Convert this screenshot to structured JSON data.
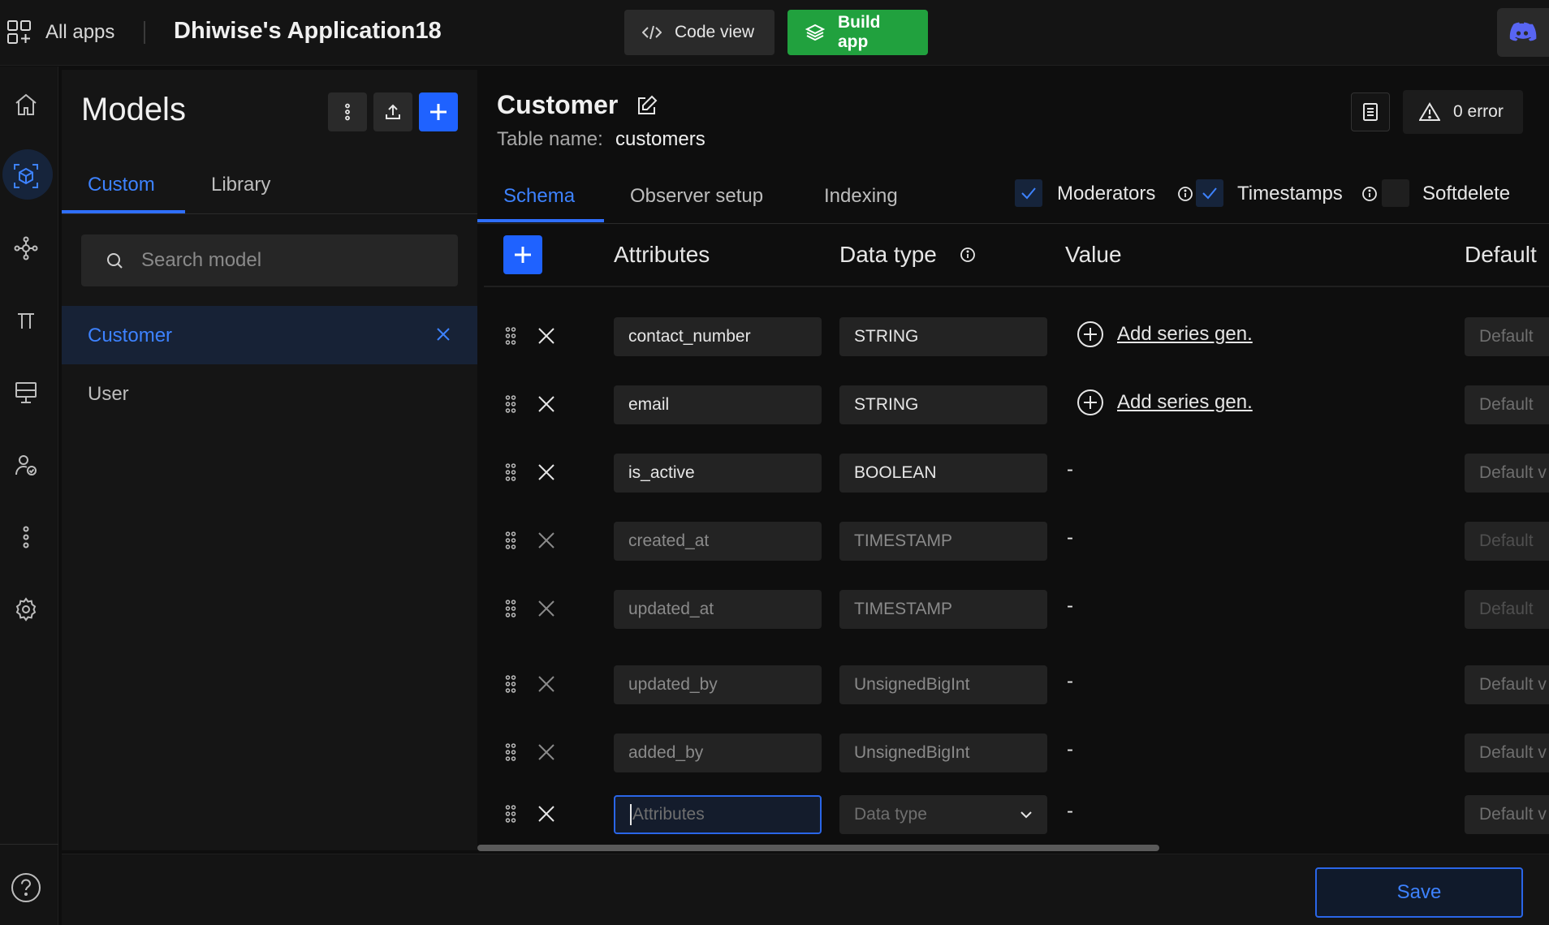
{
  "topbar": {
    "all_apps": "All apps",
    "app_title": "Dhiwise's Application18",
    "code_view": "Code view",
    "build_app": "Build app"
  },
  "colors": {
    "accent": "#1f62ff",
    "build_green": "#21a13e",
    "discord": "#5865f2"
  },
  "panel": {
    "title": "Models",
    "tabs": [
      "Custom",
      "Library"
    ],
    "search_placeholder": "Search model",
    "models": [
      "Customer",
      "User"
    ]
  },
  "main": {
    "model_name": "Customer",
    "table_name_label": "Table name:",
    "table_name": "customers",
    "error_label": "0 error",
    "tabs": [
      "Schema",
      "Observer setup",
      "Indexing"
    ],
    "options": {
      "moderators": "Moderators",
      "timestamps": "Timestamps",
      "softdelete": "Softdelete"
    },
    "headers": {
      "attributes": "Attributes",
      "data_type": "Data type",
      "value": "Value",
      "default": "Default"
    },
    "rows": [
      {
        "attr": "contact_number",
        "type": "STRING",
        "value": "Add series gen.",
        "default": "Default"
      },
      {
        "attr": "email",
        "type": "STRING",
        "value": "Add series gen.",
        "default": "Default"
      },
      {
        "attr": "is_active",
        "type": "BOOLEAN",
        "value": "-",
        "default": "Default v"
      },
      {
        "attr": "created_at",
        "type": "TIMESTAMP",
        "value": "-",
        "default": "Default"
      },
      {
        "attr": "updated_at",
        "type": "TIMESTAMP",
        "value": "-",
        "default": "Default"
      },
      {
        "attr": "updated_by",
        "type": "UnsignedBigInt",
        "value": "-",
        "default": "Default v"
      },
      {
        "attr": "added_by",
        "type": "UnsignedBigInt",
        "value": "-",
        "default": "Default v"
      }
    ],
    "new_row": {
      "attr_placeholder": "Attributes",
      "type_placeholder": "Data type",
      "value": "-",
      "default": "Default v"
    },
    "save": "Save"
  }
}
